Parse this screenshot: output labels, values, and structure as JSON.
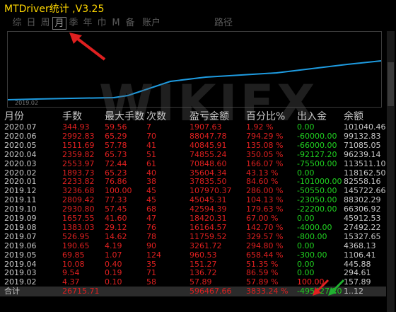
{
  "window": {
    "title": "MTDriver统计 ,V3.25"
  },
  "tabs": [
    "综",
    "日",
    "周",
    "月",
    "季",
    "年",
    "巾",
    "M",
    "备",
    "账户",
    "路径"
  ],
  "active_tab": "月",
  "chart": {
    "x_label": "2019.02",
    "line_color": "#1e9be0"
  },
  "watermark": "WIKIFX",
  "table": {
    "headers": [
      "月份",
      "手数",
      "最大手数",
      "次数",
      "盈亏金额",
      "百分比%",
      "出入金",
      "余额"
    ],
    "rows": [
      [
        "2020.07",
        "344.93",
        "59.56",
        "7",
        "1907.63",
        "1.92 %",
        "0.00",
        "101040.46"
      ],
      [
        "2020.06",
        "2992.83",
        "65.29",
        "70",
        "88047.78",
        "794.29 %",
        "-60000.00",
        "99132.83"
      ],
      [
        "2020.05",
        "1511.69",
        "57.78",
        "41",
        "40845.91",
        "135.08 %",
        "-66000.00",
        "71085.05"
      ],
      [
        "2020.04",
        "2359.82",
        "65.73",
        "51",
        "74855.24",
        "350.05 %",
        "-92127.20",
        "96239.14"
      ],
      [
        "2020.03",
        "2553.97",
        "72.44",
        "61",
        "70848.60",
        "166.07 %",
        "-75500.00",
        "113511.10"
      ],
      [
        "2020.02",
        "1893.73",
        "65.23",
        "40",
        "35604.34",
        "43.13 %",
        "0.00",
        "118162.50"
      ],
      [
        "2020.01",
        "2233.82",
        "76.86",
        "38",
        "37835.50",
        "84.60 %",
        "-101000.00",
        "82558.16"
      ],
      [
        "2019.12",
        "3236.68",
        "100.00",
        "45",
        "107970.37",
        "286.00 %",
        "-50550.00",
        "145722.66"
      ],
      [
        "2019.11",
        "2809.42",
        "77.33",
        "45",
        "45045.31",
        "104.13 %",
        "-23050.00",
        "88302.29"
      ],
      [
        "2019.10",
        "2930.80",
        "57.45",
        "68",
        "42594.39",
        "179.63 %",
        "-22200.00",
        "66306.92"
      ],
      [
        "2019.09",
        "1657.55",
        "41.60",
        "47",
        "18420.31",
        "67.00 %",
        "0.00",
        "45912.53"
      ],
      [
        "2019.08",
        "1383.03",
        "29.12",
        "76",
        "16164.57",
        "142.70 %",
        "-4000.00",
        "27492.22"
      ],
      [
        "2019.07",
        "526.95",
        "14.62",
        "78",
        "11759.52",
        "329.57 %",
        "-800.00",
        "15327.65"
      ],
      [
        "2019.06",
        "190.65",
        "4.19",
        "90",
        "3261.72",
        "294.80 %",
        "0.00",
        "4368.13"
      ],
      [
        "2019.05",
        "69.85",
        "1.07",
        "124",
        "960.53",
        "658.44 %",
        "-300.00",
        "1106.41"
      ],
      [
        "2019.04",
        "10.08",
        "0.40",
        "35",
        "151.27",
        "51.35 %",
        "0.00",
        "445.88"
      ],
      [
        "2019.03",
        "9.54",
        "0.19",
        "71",
        "136.72",
        "86.59 %",
        "0.00",
        "294.61"
      ],
      [
        "2019.02",
        "4.37",
        "0.10",
        "58",
        "57.89",
        "57.89 %",
        "100.00",
        "157.89"
      ]
    ],
    "total": [
      "合计",
      "26715.71",
      "",
      "",
      "596467.66",
      "3833.24 %",
      "-495427.20",
      "1..12"
    ]
  },
  "colors": {
    "accent_yellow": "#ffd700",
    "loss_red": "#e02020",
    "inflow_green": "#20d020",
    "deposit_red": "#ff2020",
    "arrow_red": "#e02020",
    "arrow_green": "#20b030"
  }
}
